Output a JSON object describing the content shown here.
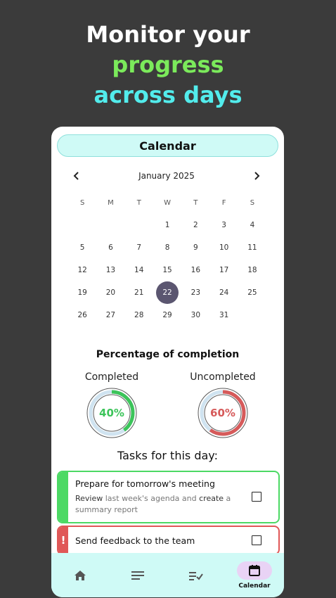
{
  "headline": {
    "line1": "Monitor your",
    "line2": "progress",
    "line3": "across days"
  },
  "calendar": {
    "title": "Calendar",
    "month": "January 2025",
    "weekdays": [
      "S",
      "M",
      "T",
      "W",
      "T",
      "F",
      "S"
    ],
    "leading_blanks": 3,
    "days": [
      "1",
      "2",
      "3",
      "4",
      "5",
      "6",
      "7",
      "8",
      "9",
      "10",
      "11",
      "12",
      "13",
      "14",
      "15",
      "16",
      "17",
      "18",
      "19",
      "20",
      "21",
      "22",
      "23",
      "24",
      "25",
      "26",
      "27",
      "28",
      "29",
      "30",
      "31"
    ],
    "selected_day": "22",
    "selected_color": "#5b5670"
  },
  "completion": {
    "title": "Percentage of completion",
    "completed": {
      "label": "Completed",
      "value_text": "40%",
      "fraction": 0.4,
      "color": "#3cc45a"
    },
    "uncompleted": {
      "label": "Uncompleted",
      "value_text": "60%",
      "fraction": 0.6,
      "color": "#d65a5a"
    }
  },
  "tasks": {
    "title": "Tasks for this day:",
    "items": [
      {
        "name": "Prepare for tomorrow's meeting",
        "desc_parts": [
          "Review",
          " last week's agenda and ",
          "create",
          " a summary report"
        ],
        "color": "#4cd964",
        "checked": false
      },
      {
        "name": "Send feedback to the team",
        "flag": "!",
        "color": "#e05757",
        "checked": false
      }
    ]
  },
  "bottom_nav": {
    "items": [
      {
        "icon": "home-icon"
      },
      {
        "icon": "notes-icon"
      },
      {
        "icon": "checklist-icon"
      },
      {
        "icon": "calendar-icon",
        "label": "Calendar",
        "active": true
      }
    ]
  }
}
